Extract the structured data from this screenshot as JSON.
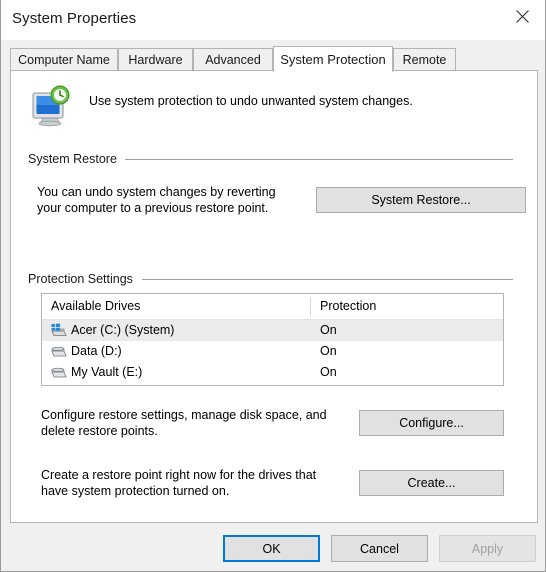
{
  "window": {
    "title": "System Properties",
    "close_icon": "close-icon"
  },
  "tabs": [
    {
      "label": "Computer Name",
      "active": false
    },
    {
      "label": "Hardware",
      "active": false
    },
    {
      "label": "Advanced",
      "active": false
    },
    {
      "label": "System Protection",
      "active": true
    },
    {
      "label": "Remote",
      "active": false
    }
  ],
  "intro": {
    "icon": "system-protection-icon",
    "text": "Use system protection to undo unwanted system changes."
  },
  "system_restore": {
    "group_label": "System Restore",
    "description_line1": "You can undo system changes by reverting",
    "description_line2": "your computer to a previous restore point.",
    "button_label": "System Restore..."
  },
  "protection_settings": {
    "group_label": "Protection Settings",
    "columns": {
      "drives": "Available Drives",
      "protection": "Protection"
    },
    "rows": [
      {
        "name": "Acer (C:) (System)",
        "protection": "On",
        "selected": true,
        "icon": "system-drive-icon"
      },
      {
        "name": "Data (D:)",
        "protection": "On",
        "selected": false,
        "icon": "drive-icon"
      },
      {
        "name": "My Vault (E:)",
        "protection": "On",
        "selected": false,
        "icon": "drive-icon"
      }
    ],
    "configure": {
      "description_line1": "Configure restore settings, manage disk space, and",
      "description_line2": "delete restore points.",
      "button_label": "Configure..."
    },
    "create": {
      "description_line1": "Create a restore point right now for the drives that",
      "description_line2": "have system protection turned on.",
      "button_label": "Create..."
    }
  },
  "footer": {
    "ok_label": "OK",
    "cancel_label": "Cancel",
    "apply_label": "Apply",
    "apply_disabled": true
  },
  "colors": {
    "accent": "#0078d7",
    "window_bg": "#f0f0f0",
    "panel_bg": "#ffffff",
    "button_bg": "#e1e1e1",
    "selection_bg": "#ebebeb"
  }
}
